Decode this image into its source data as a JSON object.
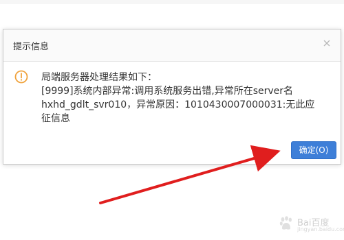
{
  "dialog": {
    "title": "提示信息",
    "message_lines": [
      "局端服务器处理结果如下：",
      "[9999]系统内部异常:调用系统服务出错,异常所在server名",
      "hxhd_gdlt_svr010，异常原因：1010430007000031:无此应",
      "征信息"
    ],
    "ok_button_label": "确定(O)"
  },
  "colors": {
    "warning_icon": "#f0a23b",
    "ok_button": "#3e7fd8",
    "annotation_arrow": "#e01e1e"
  },
  "icons": {
    "close": "close-icon",
    "warning": "exclamation-circle-icon"
  },
  "watermark": {
    "brand": "Bai百度",
    "sub": "jingyan.baidu.com"
  }
}
